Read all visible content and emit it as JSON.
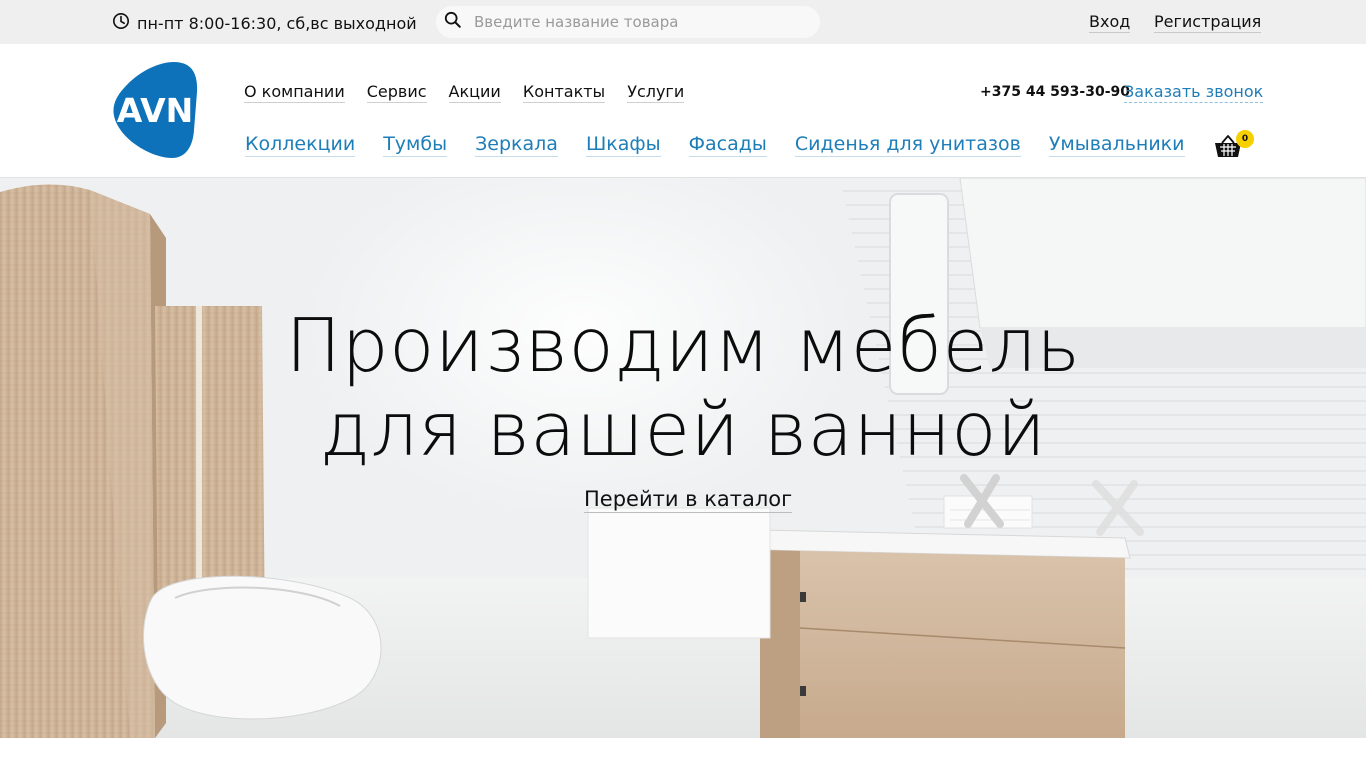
{
  "topbar": {
    "hours": "пн-пт 8:00-16:30, сб,вс выходной",
    "search_placeholder": "Введите название товара",
    "search_value": "",
    "login": "Вход",
    "register": "Регистрация"
  },
  "header": {
    "logo_text": "AVN",
    "top_nav": [
      "О компании",
      "Сервис",
      "Акции",
      "Контакты",
      "Услуги"
    ],
    "phone": "+375 44 593-30-90",
    "callback": "Заказать звонок",
    "categories": [
      "Коллекции",
      "Тумбы",
      "Зеркала",
      "Шкафы",
      "Фасады",
      "Сиденья для унитазов",
      "Умывальники"
    ],
    "cart_count": "0"
  },
  "hero": {
    "title_line1": "Производим мебель",
    "title_line2": "для вашей ванной",
    "cta": "Перейти в каталог"
  },
  "colors": {
    "accent": "#1e7eb8",
    "logo_blue": "#0d72b9",
    "topbar_bg": "#efefef",
    "badge": "#f6d000"
  },
  "icons": {
    "hours": "clock-icon",
    "search": "search-icon",
    "cart": "basket-icon"
  }
}
